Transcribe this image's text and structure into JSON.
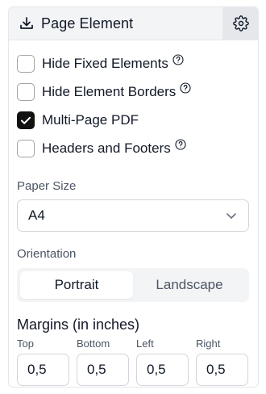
{
  "header": {
    "title": "Page Element",
    "download_icon": "download-icon",
    "settings_icon": "gear-icon"
  },
  "options": [
    {
      "label": "Hide Fixed Elements",
      "checked": false,
      "help": true
    },
    {
      "label": "Hide Element Borders",
      "checked": false,
      "help": true
    },
    {
      "label": "Multi-Page PDF",
      "checked": true,
      "help": false
    },
    {
      "label": "Headers and Footers",
      "checked": false,
      "help": true
    }
  ],
  "paper_size": {
    "label": "Paper Size",
    "value": "A4"
  },
  "orientation": {
    "label": "Orientation",
    "options": [
      "Portrait",
      "Landscape"
    ],
    "selected": "Portrait"
  },
  "margins": {
    "title": "Margins (in inches)",
    "fields": [
      {
        "label": "Top",
        "value": "0,5"
      },
      {
        "label": "Bottom",
        "value": "0,5"
      },
      {
        "label": "Left",
        "value": "0,5"
      },
      {
        "label": "Right",
        "value": "0,5"
      }
    ]
  },
  "colors": {
    "accent": "#111111",
    "header_bg": "#f3f4f6",
    "border": "#d1d5db"
  }
}
